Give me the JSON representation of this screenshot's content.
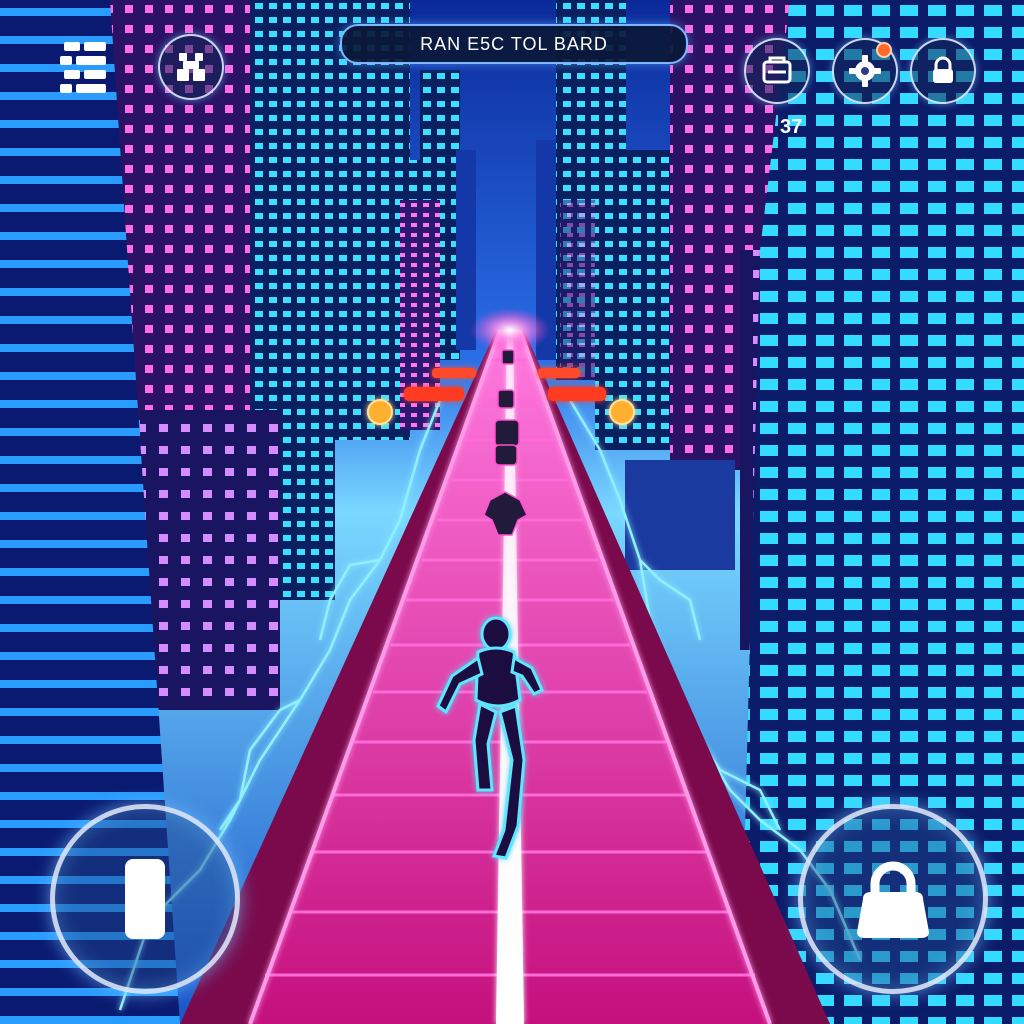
{
  "hud": {
    "title": "RAN E5C TOL BARD",
    "counter": "37",
    "icons": {
      "menu": "menu-grid-icon",
      "character": "character-badge-icon",
      "shop": "shop-icon",
      "settings": "settings-gear-icon",
      "lock_small": "lock-icon",
      "left_control": "slide-icon",
      "right_control": "lock-icon"
    }
  },
  "colors": {
    "track": "#d6158f",
    "track_line": "#ff4fd0",
    "center_beam": "#ffffff",
    "building_cyan": "#2fd8ff",
    "building_magenta": "#ff5ae0",
    "sky_top": "#0b2a9a",
    "sky_glow": "#3fb6ff",
    "lightning": "#7fe3ff",
    "notification": "#ff6a2a"
  }
}
